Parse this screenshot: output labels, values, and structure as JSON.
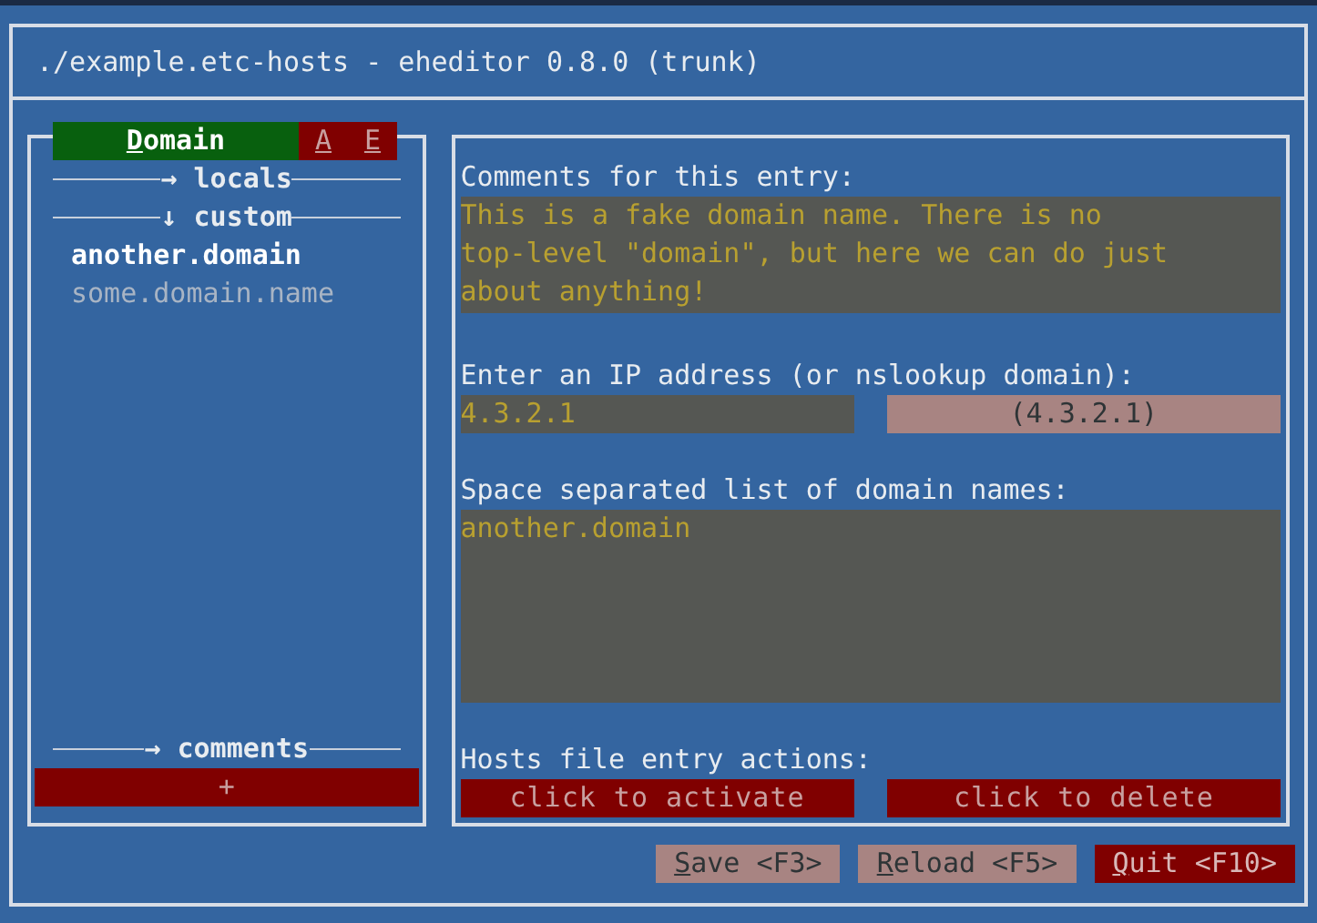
{
  "window": {
    "title": "./example.etc-hosts - eheditor 0.8.0 (trunk)"
  },
  "tabs": [
    {
      "hotkey": "D",
      "label": "omain",
      "selected": true
    },
    {
      "hotkey": "A",
      "selected": false
    },
    {
      "hotkey": "E",
      "selected": false
    }
  ],
  "sidebar": {
    "items": [
      {
        "kind": "group",
        "arrow": "→",
        "label": "locals"
      },
      {
        "kind": "group",
        "arrow": "↓",
        "label": "custom"
      },
      {
        "kind": "entry",
        "label": "another.domain",
        "selected": true
      },
      {
        "kind": "entry",
        "label": "some.domain.name",
        "selected": false
      }
    ],
    "footer_group": {
      "arrow": "→",
      "label": "comments"
    },
    "add_button": "+"
  },
  "form": {
    "comments_label": "Comments for this entry:",
    "comments_value": "This is a fake domain name. There is no top-level \"domain\", but here we can do just about anything!",
    "ip_label": "Enter an IP address (or nslookup domain):",
    "ip_value": "4.3.2.1",
    "ip_lookup": "(4.3.2.1)",
    "domains_label": "Space separated list of domain names:",
    "domains_value": "another.domain",
    "actions_label": "Hosts file entry actions:",
    "actions": [
      "click to activate",
      "click to delete"
    ]
  },
  "buttons": [
    {
      "hotkey": "S",
      "label": "ave <F3>",
      "disabled": true
    },
    {
      "hotkey": "R",
      "label": "eload <F5>",
      "disabled": true
    },
    {
      "hotkey": "Q",
      "label": "uit <F10>",
      "disabled": false
    }
  ]
}
